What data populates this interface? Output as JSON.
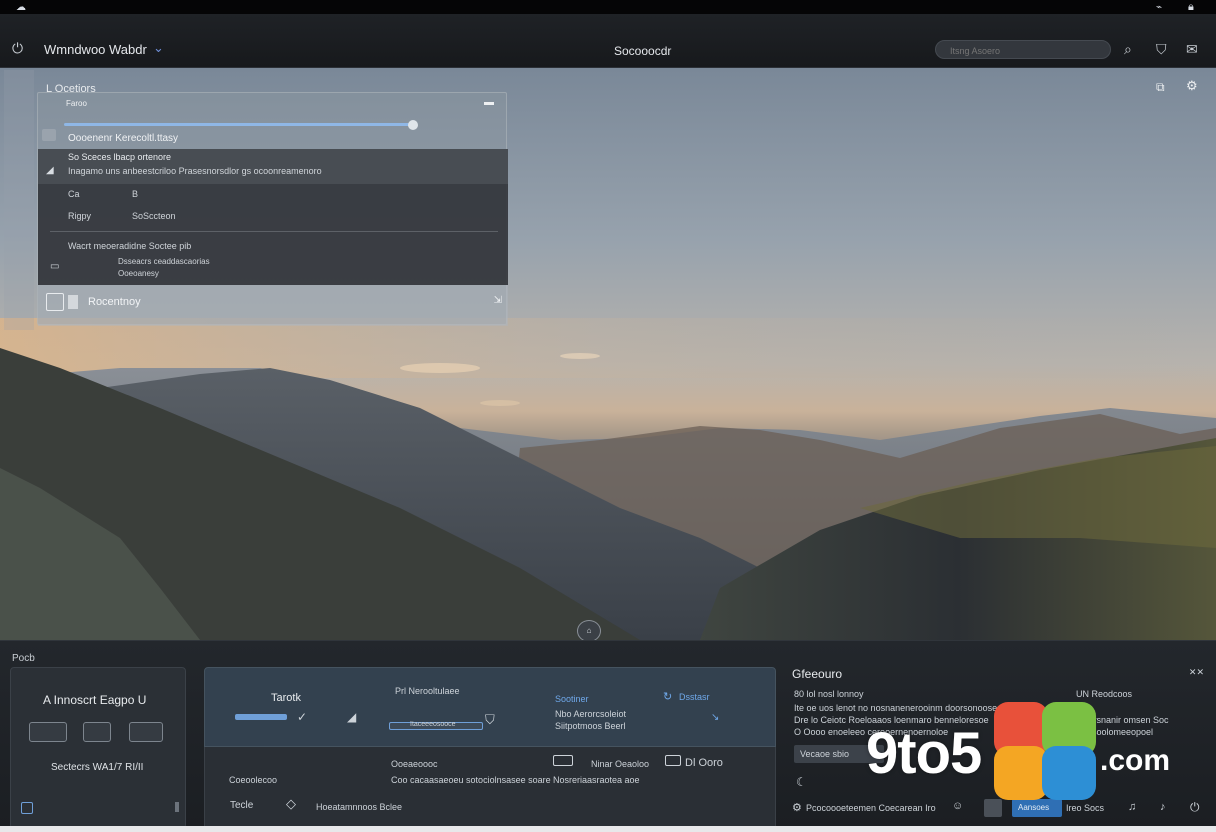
{
  "topbar": {
    "app_title": "Wmndwoo Wabdr",
    "center_title": "Socooocdr",
    "search_placeholder": "Itsng Asoero"
  },
  "notification_panel": {
    "label": "L Ocetiors",
    "subtitle": "Faroo",
    "status": "Oooenenr Kerecoltl.ttasy",
    "row_title": "So Sceces lbacp ortenore",
    "row_text": "Inagamo uns anbeestcriloo Prasesnorsdlor gs ocoonreamenoro",
    "kv": [
      {
        "k": "Ca",
        "v": "B"
      },
      {
        "k": "Rigpy",
        "v": "SoSccteon"
      }
    ],
    "note": "Wacrt meoeradidne Soctee pib",
    "note_line1": "Dsseacrs ceaddascaorias",
    "note_line2": "Ooeoanesy",
    "footer_label": "Rocentnoy"
  },
  "dock": {
    "label": "Pocb",
    "card1": {
      "title": "A Innoscrt Eagpo U",
      "caption": "Sectecrs WA1/7 RI/II"
    },
    "card2": {
      "title": "Tarotk",
      "col2_title": "Prl Nerooltulaee",
      "col2_field": "Itaceeeosooce",
      "col3_blue": "Sootiner",
      "col3_line1": "Nbo Aerorcsoleiot",
      "col3_line2": "Siitpotmoos Beerl",
      "col4_blue": "Dsstasr",
      "lower_left": "Coeoolecoo",
      "lower_mid_title": "Ooeaeoooc",
      "lower_mid_text": "Coo cacaasaeoeu sotociolnsasee soare",
      "lower_r1": "Ninar Oeaoloo",
      "lower_r1b": "Nosreriaasraotea aoe",
      "lower_r2": "Dl Ooro"
    },
    "card3": {
      "title": "Gfeeouro",
      "l1": "80 lol nosl lonnoy",
      "r1": "UN Reodcoos",
      "l2": "Ite oe uos lenot no nosnanenerooinm doorsonooseeretesoe",
      "l3": "Dre lo Ceiotc Roeloaaos loenmaro benneloresoe",
      "l4": "O Oooo enoeleeo cerooernenoernoloe",
      "r2": "Ierersnanir omsen Soc",
      "r3": "Ioslsoolomeeopoel",
      "pill": "Vecaoe sbio"
    }
  },
  "taskbar": {
    "left_label": "Tecle",
    "left_text": "Hoeatamnnoos Bclee",
    "right_text": "Pcocoooeteemen Coecarean Iro",
    "btn_label": "Aansoes",
    "tray_text": "Ireo Socs"
  },
  "watermark": {
    "logo": "9to5",
    "domain": ".com"
  },
  "colors": {
    "accent": "#6f9fd8",
    "panel": "#2b3036",
    "topbar": "#1b1e22"
  }
}
